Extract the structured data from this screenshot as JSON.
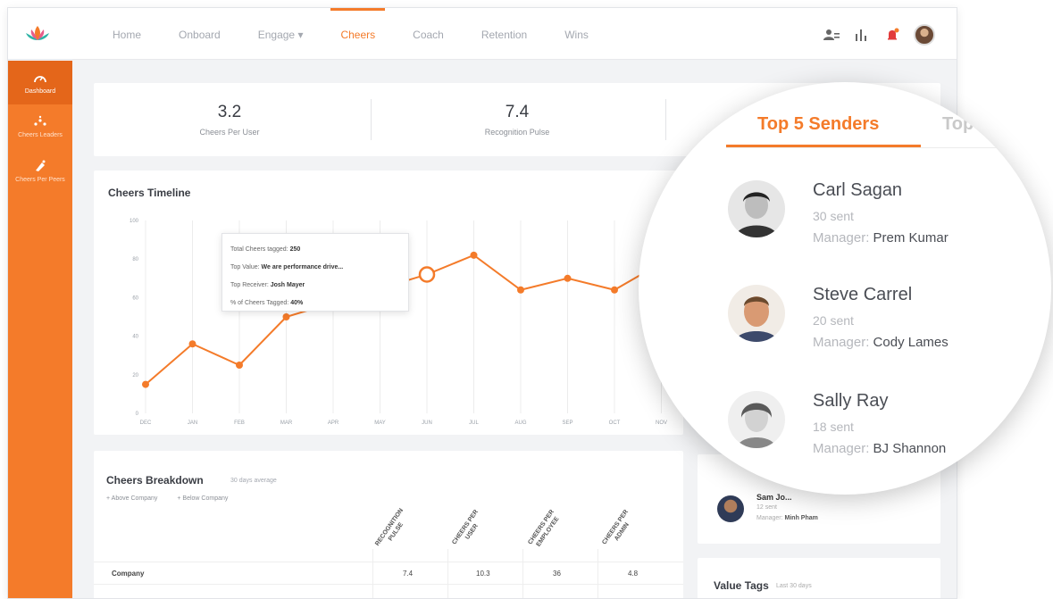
{
  "nav": {
    "items": [
      {
        "label": "Home",
        "active": false
      },
      {
        "label": "Onboard",
        "active": false
      },
      {
        "label": "Engage",
        "active": false,
        "dropdown": true
      },
      {
        "label": "Cheers",
        "active": true
      },
      {
        "label": "Coach",
        "active": false
      },
      {
        "label": "Retention",
        "active": false
      },
      {
        "label": "Wins",
        "active": false
      }
    ],
    "dropdown_caret": "▾",
    "icons": [
      "users-icon",
      "bar-chart-icon",
      "notification-bell-icon",
      "user-avatar"
    ]
  },
  "sidebar": {
    "items": [
      {
        "label": "Dashboard",
        "icon": "gauge-icon",
        "active": true
      },
      {
        "label": "Cheers Leaders",
        "icon": "leaders-icon",
        "active": false
      },
      {
        "label": "Cheers Per Peers",
        "icon": "peers-icon",
        "active": false
      }
    ]
  },
  "stats": [
    {
      "value": "3.2",
      "label": "Cheers Per User"
    },
    {
      "value": "7.4",
      "label": "Recognition Pulse"
    }
  ],
  "timeline": {
    "title": "Cheers Timeline",
    "tooltip": {
      "total_label": "Total Cheers tagged:",
      "total_value": "250",
      "top_value_label": "Top Value:",
      "top_value": "We are performance drive...",
      "top_receiver_label": "Top Receiver:",
      "top_receiver": "Josh Mayer",
      "pct_label": "% of Cheers Tagged:",
      "pct_value": "40%"
    }
  },
  "chart_data": {
    "type": "line",
    "title": "Cheers Timeline",
    "categories": [
      "DEC",
      "JAN",
      "FEB",
      "MAR",
      "APR",
      "MAY",
      "JUN",
      "JUL",
      "AUG",
      "SEP",
      "OCT",
      "NOV"
    ],
    "values": [
      15,
      36,
      25,
      50,
      null,
      null,
      72,
      82,
      64,
      70,
      64,
      78
    ],
    "highlighted_category": "JUN",
    "ylim": [
      0,
      100
    ],
    "yticks": [
      0,
      20,
      40,
      60,
      80,
      100
    ],
    "grid": "vertical",
    "color": "#f47b2a"
  },
  "breakdown": {
    "title": "Cheers Breakdown",
    "subtitle": "30 days average",
    "legend": [
      "Above Company",
      "Below Company"
    ],
    "columns": [
      "RECOGNITION\nPULSE",
      "CHEERS PER\nUSER",
      "CHEERS PER\nEMPLOYEE",
      "CHEERS PER\nADMIN"
    ],
    "rows": [
      {
        "name": "Company",
        "values": [
          "7.4",
          "10.3",
          "36",
          "4.8"
        ]
      }
    ]
  },
  "top_senders": {
    "tabs": [
      {
        "label": "Top 5 Senders",
        "active": true
      },
      {
        "label": "Top",
        "active": false
      }
    ],
    "manager_prefix": "Manager:",
    "senders": [
      {
        "name": "Carl Sagan",
        "sent": "30 sent",
        "manager": "Prem Kumar"
      },
      {
        "name": "Steve Carrel",
        "sent": "20 sent",
        "manager": "Cody Lames"
      },
      {
        "name": "Sally Ray",
        "sent": "18 sent",
        "manager": "BJ Shannon"
      }
    ],
    "partial": {
      "name": "Sam Jo...",
      "sent": "12 sent",
      "manager_label": "Manager:",
      "manager": "Minh Pham"
    }
  },
  "value_tags": {
    "title": "Value Tags",
    "subtitle": "Last 30 days"
  },
  "colors": {
    "accent": "#f47b2a",
    "sidebar": "#f47b2a",
    "sidebar_active": "#e4661a"
  }
}
